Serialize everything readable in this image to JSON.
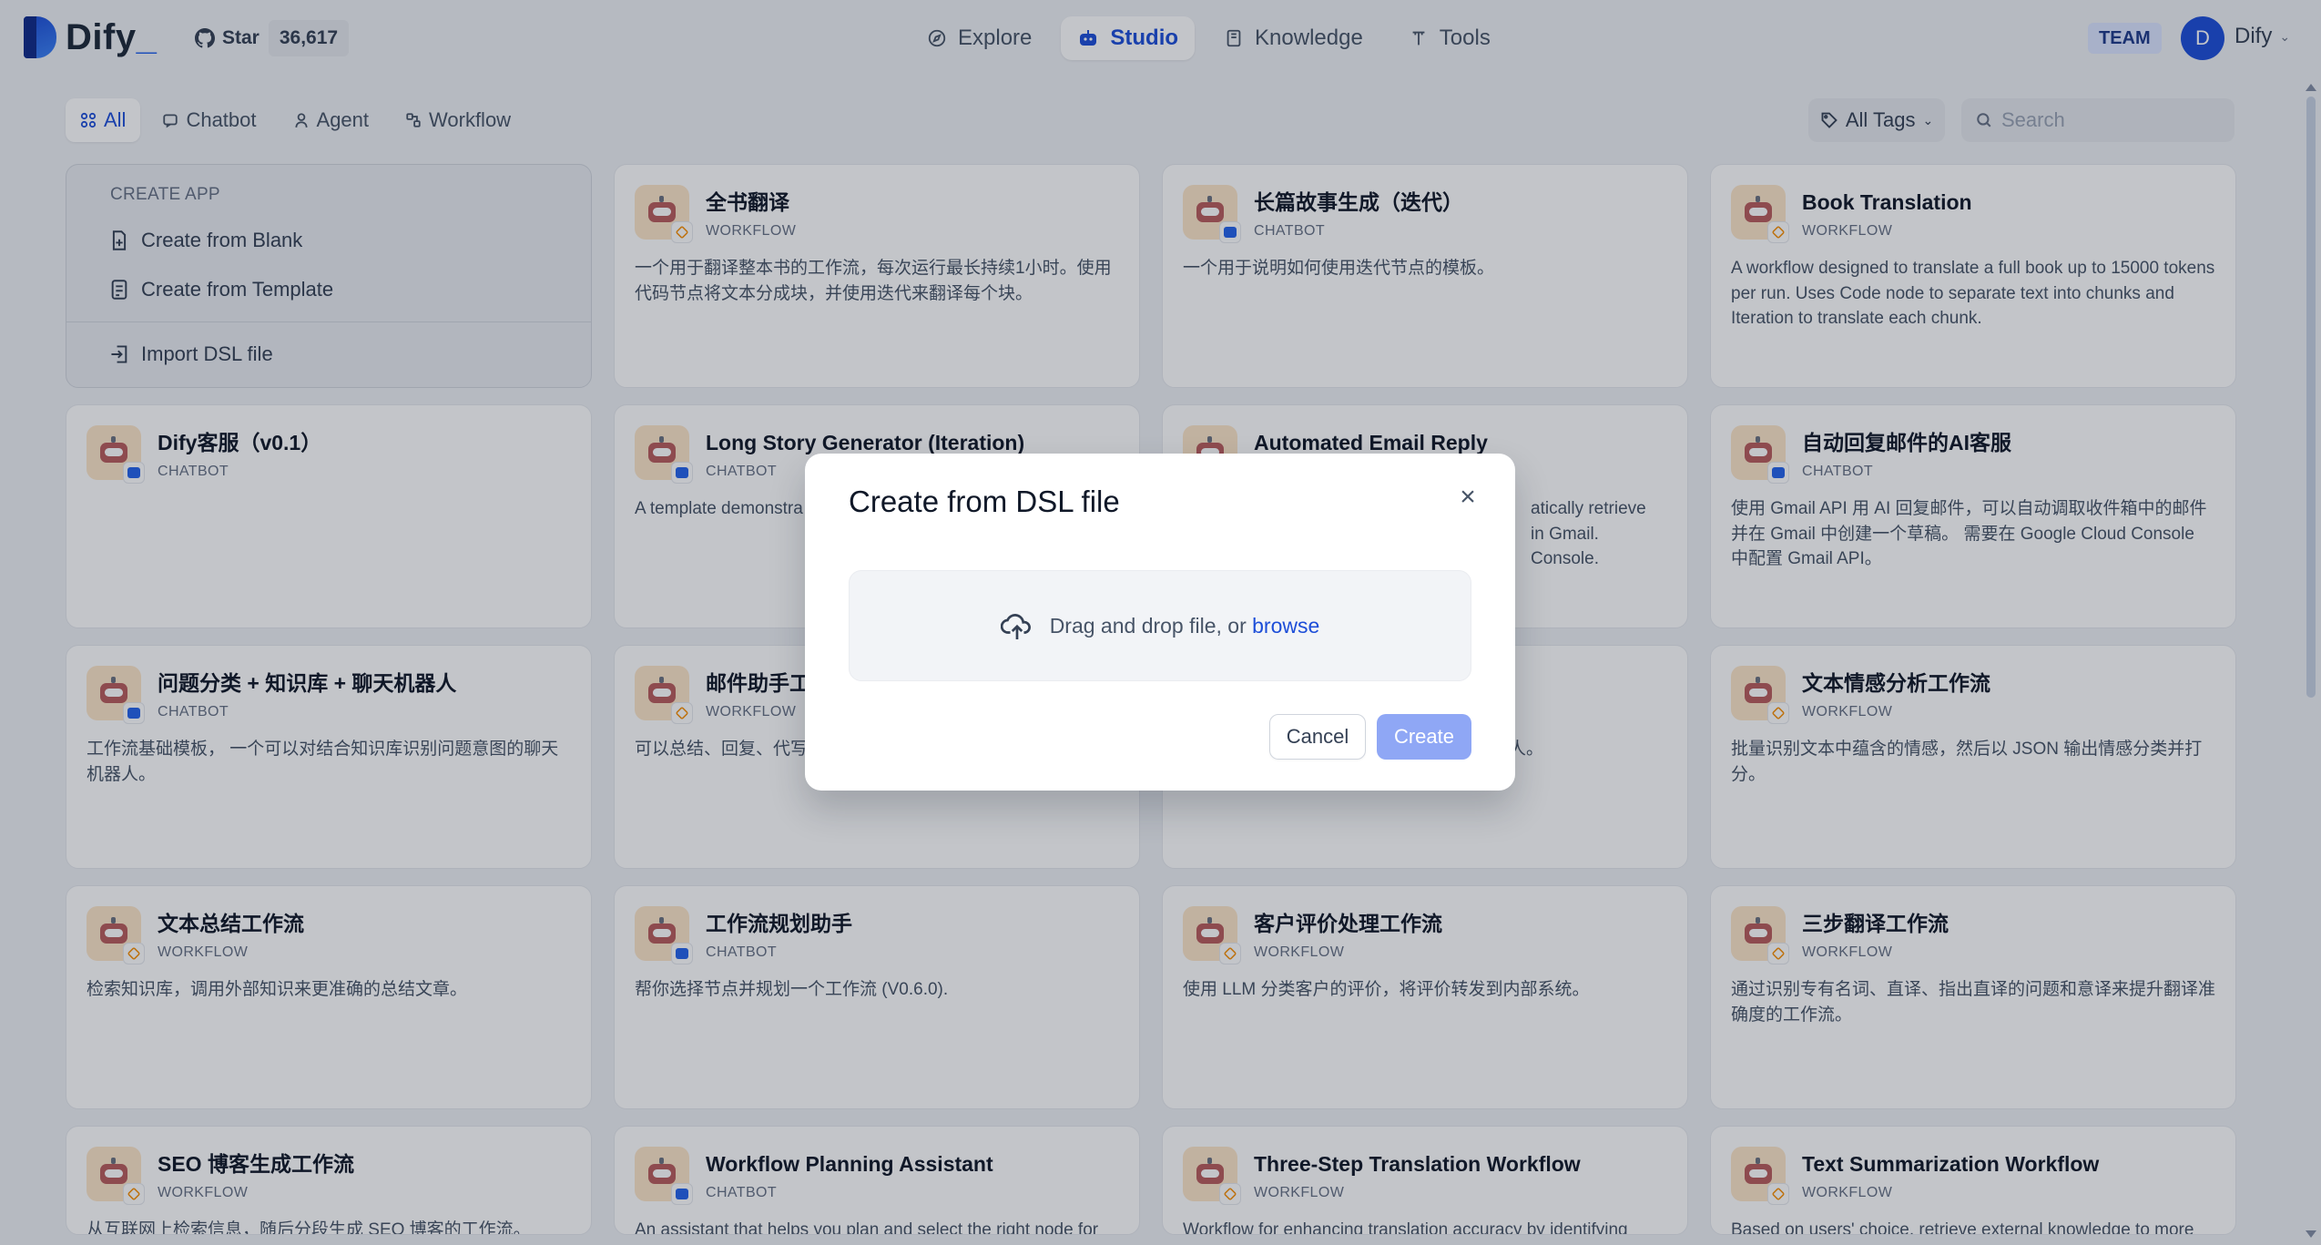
{
  "app": {
    "name": "Dify",
    "cursor": "_"
  },
  "github": {
    "star_label": "Star",
    "star_count": "36,617"
  },
  "nav": [
    {
      "label": "Explore",
      "icon": "compass-icon"
    },
    {
      "label": "Studio",
      "icon": "robot-icon",
      "active": true
    },
    {
      "label": "Knowledge",
      "icon": "book-icon"
    },
    {
      "label": "Tools",
      "icon": "tools-icon"
    }
  ],
  "account": {
    "team_badge": "TEAM",
    "avatar_initial": "D",
    "name": "Dify"
  },
  "filters": {
    "tabs": [
      {
        "label": "All",
        "active": true
      },
      {
        "label": "Chatbot"
      },
      {
        "label": "Agent"
      },
      {
        "label": "Workflow"
      }
    ],
    "tags_label": "All Tags",
    "search_placeholder": "Search"
  },
  "create_app": {
    "title": "CREATE APP",
    "blank": "Create from Blank",
    "template": "Create from Template",
    "import": "Import DSL file"
  },
  "cards": [
    {
      "title": "全书翻译",
      "type": "WORKFLOW",
      "desc": "一个用于翻译整本书的工作流，每次运行最长持续1小时。使用代码节点将文本分成块，并使用迭代来翻译每个块。"
    },
    {
      "title": "长篇故事生成（迭代）",
      "type": "CHATBOT",
      "desc": "一个用于说明如何使用迭代节点的模板。"
    },
    {
      "title": "Book Translation",
      "type": "WORKFLOW",
      "desc": "A workflow designed to translate a full book up to 15000 tokens per run. Uses Code node to separate text into chunks and Iteration to translate each chunk."
    },
    {
      "title": "Dify客服（v0.1）",
      "type": "CHATBOT",
      "desc": ""
    },
    {
      "title": "Long Story Generator (Iteration)",
      "type": "CHATBOT",
      "desc": "A template demonstra"
    },
    {
      "title": "Automated Email Reply",
      "type": "WORKFLOW",
      "desc": "atically retrieve\nin Gmail.\nConsole."
    },
    {
      "title": "自动回复邮件的AI客服",
      "type": "CHATBOT",
      "desc": "使用 Gmail API 用 AI 回复邮件，可以自动调取收件箱中的邮件并在 Gmail 中创建一个草稿。 需要在 Google Cloud Console 中配置 Gmail API。"
    },
    {
      "title": "问题分类 + 知识库 + 聊天机器人",
      "type": "CHATBOT",
      "desc": "工作流基础模板， 一个可以对结合知识库识别问题意图的聊天机器人。"
    },
    {
      "title": "邮件助手工作",
      "type": "WORKFLOW",
      "desc": "可以总结、回复、代写、"
    },
    {
      "title": "",
      "type": "",
      "desc": "机器人。"
    },
    {
      "title": "文本情感分析工作流",
      "type": "WORKFLOW",
      "desc": "批量识别文本中蕴含的情感，然后以 JSON 输出情感分类并打分。"
    },
    {
      "title": "文本总结工作流",
      "type": "WORKFLOW",
      "desc": "检索知识库，调用外部知识来更准确的总结文章。"
    },
    {
      "title": "工作流规划助手",
      "type": "CHATBOT",
      "desc": "帮你选择节点并规划一个工作流 (V0.6.0)."
    },
    {
      "title": "客户评价处理工作流",
      "type": "WORKFLOW",
      "desc": "使用 LLM 分类客户的评价，将评价转发到内部系统。"
    },
    {
      "title": "三步翻译工作流",
      "type": "WORKFLOW",
      "desc": "通过识别专有名词、直译、指出直译的问题和意译来提升翻译准确度的工作流。"
    },
    {
      "title": "SEO 博客生成工作流",
      "type": "WORKFLOW",
      "desc": "从互联网上检索信息，随后分段生成 SEO 博客的工作流。"
    },
    {
      "title": "Workflow Planning Assistant",
      "type": "CHATBOT",
      "desc": "An assistant that helps you plan and select the right node for"
    },
    {
      "title": "Three-Step Translation Workflow",
      "type": "WORKFLOW",
      "desc": "Workflow for enhancing translation accuracy by identifying"
    },
    {
      "title": "Text Summarization Workflow",
      "type": "WORKFLOW",
      "desc": "Based on users' choice, retrieve external knowledge to more"
    }
  ],
  "modal": {
    "title": "Create from DSL file",
    "drop_text": "Drag and drop file, or ",
    "browse": "browse",
    "cancel": "Cancel",
    "create": "Create"
  }
}
